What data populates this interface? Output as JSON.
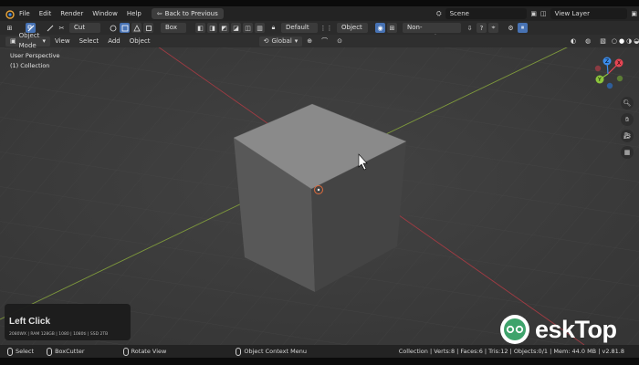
{
  "menubar": {
    "items": [
      "File",
      "Edit",
      "Render",
      "Window",
      "Help"
    ],
    "back_button": "Back to Previous",
    "scene": "Scene",
    "view_layer": "View Layer"
  },
  "toolheader": {
    "cut_label": "Cut",
    "shape_label": "Box",
    "default_label": "Default",
    "object_label": "Object",
    "mode_label": "Non-Destructive"
  },
  "viewport_header": {
    "mode": "Object Mode",
    "menus": [
      "View",
      "Select",
      "Add",
      "Object"
    ],
    "transform_orientation": "Global"
  },
  "viewport": {
    "perspective": "User Perspective",
    "collection": "(1) Collection"
  },
  "gizmo": {
    "x_label": "X",
    "y_label": "Y",
    "z_label": "Z",
    "x_color": "#e64553",
    "y_color": "#8cc43c",
    "z_color": "#3b8bea"
  },
  "overlay": {
    "title": "Left Click",
    "specs": "2080WX | RAM 128GB | 1080 | 1080ti | SSD 2TB"
  },
  "statusbar": {
    "select": "Select",
    "boxcutter": "BoxCutter",
    "rotate": "Rotate View",
    "context": "Object Context Menu",
    "stats": "Collection | Verts:8 | Faces:6 | Tris:12 | Objects:0/1 | Mem: 44.0 MB | v2.81.8"
  },
  "watermark": {
    "text": "eskTop"
  }
}
